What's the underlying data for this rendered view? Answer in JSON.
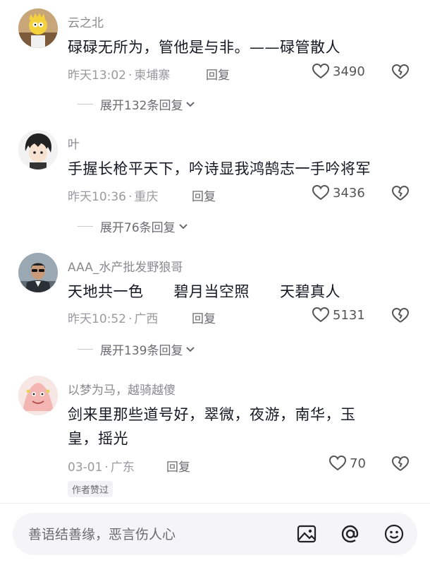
{
  "comments": [
    {
      "username": "云之北",
      "content": "碌碌无所为，管他是与非。——碌管散人",
      "date": "昨天13:02",
      "location": "柬埔寨",
      "reply_label": "回复",
      "likes": "3490",
      "expand_label": "展开132条回复"
    },
    {
      "username": "叶",
      "content": "手握长枪平天下，吟诗显我鸿鹄志一手吟将军",
      "date": "昨天10:36",
      "location": "重庆",
      "reply_label": "回复",
      "likes": "3436",
      "expand_label": "展开76条回复"
    },
    {
      "username": "AAA_水产批发野狼哥",
      "content": "天地共一色　　碧月当空照　　天碧真人",
      "date": "昨天10:52",
      "location": "广西",
      "reply_label": "回复",
      "likes": "5131",
      "expand_label": "展开139条回复"
    },
    {
      "username": "以梦为马，越骑越傻",
      "content": "剑来里那些道号好，翠微，夜游，南华，玉皇，摇光",
      "date": "03-01",
      "location": "广东",
      "reply_label": "回复",
      "likes": "70",
      "badge": "作者赞过"
    }
  ],
  "meta_separator": "·",
  "input": {
    "placeholder": "善语结善缘，恶言伤人心"
  },
  "icons": {
    "like": "heart-outline-icon",
    "dislike": "broken-heart-icon",
    "expand": "chevron-down-icon",
    "image": "image-icon",
    "mention": "at-icon",
    "emoji": "smiley-icon"
  },
  "colors": {
    "text_primary": "#161823",
    "text_secondary": "#8a8a8f",
    "input_bg": "#f5f5f7"
  }
}
